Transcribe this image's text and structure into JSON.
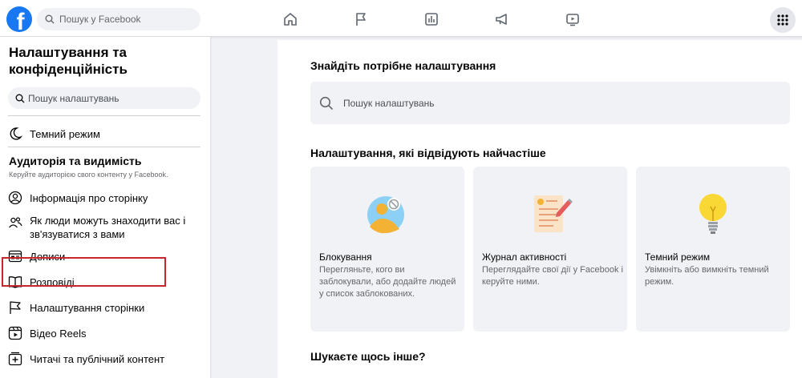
{
  "topbar": {
    "search_placeholder": "Пошук у Facebook",
    "nav_icons": [
      "home-icon",
      "flag-icon",
      "insights-icon",
      "megaphone-icon",
      "video-icon"
    ],
    "menu_icon": "grid-icon"
  },
  "sidebar": {
    "title": "Налаштування та конфіденційність",
    "search_placeholder": "Пошук налаштувань",
    "dark_mode_label": "Темний режим",
    "section_title": "Аудиторія та видимість",
    "section_subtitle": "Керуйте аудиторією свого контенту у Facebook.",
    "items": [
      {
        "label": "Інформація про сторінку",
        "icon": "user-circle-icon"
      },
      {
        "label": "Як люди можуть знаходити вас і зв'язуватися з вами",
        "icon": "people-icon"
      },
      {
        "label": "Дописи",
        "icon": "posts-icon"
      },
      {
        "label": "Розповіді",
        "icon": "book-icon"
      },
      {
        "label": "Налаштування сторінки",
        "icon": "flag-icon"
      },
      {
        "label": "Відео Reels",
        "icon": "reels-icon"
      },
      {
        "label": "Читачі та публічний контент",
        "icon": "add-follower-icon"
      }
    ]
  },
  "main": {
    "find_title": "Знайдіть потрібне налаштування",
    "search_placeholder": "Пошук налаштувань",
    "often_title": "Налаштування, які відвідують найчастіше",
    "cards": [
      {
        "title": "Блокування",
        "desc": "Перегляньте, кого ви заблокували, або додайте людей у список заблокованих.",
        "icon": "block-user-icon"
      },
      {
        "title": "Журнал активності",
        "desc": "Переглядайте свої дії у Facebook і керуйте ними.",
        "icon": "activity-log-icon"
      },
      {
        "title": "Темний режим",
        "desc": "Увімкніть або вимкніть темний режим.",
        "icon": "lightbulb-icon"
      }
    ],
    "else_title": "Шукаєте щось інше?"
  },
  "colors": {
    "brand": "#1877f2",
    "highlight": "#c8262c",
    "background": "#f0f2f5"
  }
}
